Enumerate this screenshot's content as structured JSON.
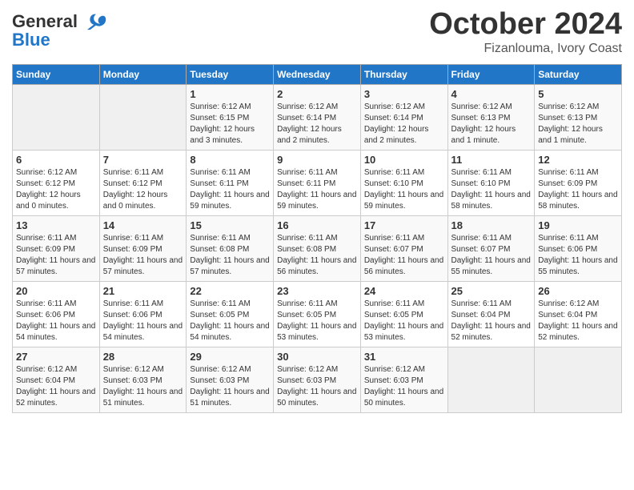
{
  "header": {
    "logo_line1": "General",
    "logo_line2": "Blue",
    "month_title": "October 2024",
    "subtitle": "Fizanlouma, Ivory Coast"
  },
  "days_of_week": [
    "Sunday",
    "Monday",
    "Tuesday",
    "Wednesday",
    "Thursday",
    "Friday",
    "Saturday"
  ],
  "weeks": [
    [
      {
        "day": "",
        "info": ""
      },
      {
        "day": "",
        "info": ""
      },
      {
        "day": "1",
        "info": "Sunrise: 6:12 AM\nSunset: 6:15 PM\nDaylight: 12 hours and 3 minutes."
      },
      {
        "day": "2",
        "info": "Sunrise: 6:12 AM\nSunset: 6:14 PM\nDaylight: 12 hours and 2 minutes."
      },
      {
        "day": "3",
        "info": "Sunrise: 6:12 AM\nSunset: 6:14 PM\nDaylight: 12 hours and 2 minutes."
      },
      {
        "day": "4",
        "info": "Sunrise: 6:12 AM\nSunset: 6:13 PM\nDaylight: 12 hours and 1 minute."
      },
      {
        "day": "5",
        "info": "Sunrise: 6:12 AM\nSunset: 6:13 PM\nDaylight: 12 hours and 1 minute."
      }
    ],
    [
      {
        "day": "6",
        "info": "Sunrise: 6:12 AM\nSunset: 6:12 PM\nDaylight: 12 hours and 0 minutes."
      },
      {
        "day": "7",
        "info": "Sunrise: 6:11 AM\nSunset: 6:12 PM\nDaylight: 12 hours and 0 minutes."
      },
      {
        "day": "8",
        "info": "Sunrise: 6:11 AM\nSunset: 6:11 PM\nDaylight: 11 hours and 59 minutes."
      },
      {
        "day": "9",
        "info": "Sunrise: 6:11 AM\nSunset: 6:11 PM\nDaylight: 11 hours and 59 minutes."
      },
      {
        "day": "10",
        "info": "Sunrise: 6:11 AM\nSunset: 6:10 PM\nDaylight: 11 hours and 59 minutes."
      },
      {
        "day": "11",
        "info": "Sunrise: 6:11 AM\nSunset: 6:10 PM\nDaylight: 11 hours and 58 minutes."
      },
      {
        "day": "12",
        "info": "Sunrise: 6:11 AM\nSunset: 6:09 PM\nDaylight: 11 hours and 58 minutes."
      }
    ],
    [
      {
        "day": "13",
        "info": "Sunrise: 6:11 AM\nSunset: 6:09 PM\nDaylight: 11 hours and 57 minutes."
      },
      {
        "day": "14",
        "info": "Sunrise: 6:11 AM\nSunset: 6:09 PM\nDaylight: 11 hours and 57 minutes."
      },
      {
        "day": "15",
        "info": "Sunrise: 6:11 AM\nSunset: 6:08 PM\nDaylight: 11 hours and 57 minutes."
      },
      {
        "day": "16",
        "info": "Sunrise: 6:11 AM\nSunset: 6:08 PM\nDaylight: 11 hours and 56 minutes."
      },
      {
        "day": "17",
        "info": "Sunrise: 6:11 AM\nSunset: 6:07 PM\nDaylight: 11 hours and 56 minutes."
      },
      {
        "day": "18",
        "info": "Sunrise: 6:11 AM\nSunset: 6:07 PM\nDaylight: 11 hours and 55 minutes."
      },
      {
        "day": "19",
        "info": "Sunrise: 6:11 AM\nSunset: 6:06 PM\nDaylight: 11 hours and 55 minutes."
      }
    ],
    [
      {
        "day": "20",
        "info": "Sunrise: 6:11 AM\nSunset: 6:06 PM\nDaylight: 11 hours and 54 minutes."
      },
      {
        "day": "21",
        "info": "Sunrise: 6:11 AM\nSunset: 6:06 PM\nDaylight: 11 hours and 54 minutes."
      },
      {
        "day": "22",
        "info": "Sunrise: 6:11 AM\nSunset: 6:05 PM\nDaylight: 11 hours and 54 minutes."
      },
      {
        "day": "23",
        "info": "Sunrise: 6:11 AM\nSunset: 6:05 PM\nDaylight: 11 hours and 53 minutes."
      },
      {
        "day": "24",
        "info": "Sunrise: 6:11 AM\nSunset: 6:05 PM\nDaylight: 11 hours and 53 minutes."
      },
      {
        "day": "25",
        "info": "Sunrise: 6:11 AM\nSunset: 6:04 PM\nDaylight: 11 hours and 52 minutes."
      },
      {
        "day": "26",
        "info": "Sunrise: 6:12 AM\nSunset: 6:04 PM\nDaylight: 11 hours and 52 minutes."
      }
    ],
    [
      {
        "day": "27",
        "info": "Sunrise: 6:12 AM\nSunset: 6:04 PM\nDaylight: 11 hours and 52 minutes."
      },
      {
        "day": "28",
        "info": "Sunrise: 6:12 AM\nSunset: 6:03 PM\nDaylight: 11 hours and 51 minutes."
      },
      {
        "day": "29",
        "info": "Sunrise: 6:12 AM\nSunset: 6:03 PM\nDaylight: 11 hours and 51 minutes."
      },
      {
        "day": "30",
        "info": "Sunrise: 6:12 AM\nSunset: 6:03 PM\nDaylight: 11 hours and 50 minutes."
      },
      {
        "day": "31",
        "info": "Sunrise: 6:12 AM\nSunset: 6:03 PM\nDaylight: 11 hours and 50 minutes."
      },
      {
        "day": "",
        "info": ""
      },
      {
        "day": "",
        "info": ""
      }
    ]
  ]
}
